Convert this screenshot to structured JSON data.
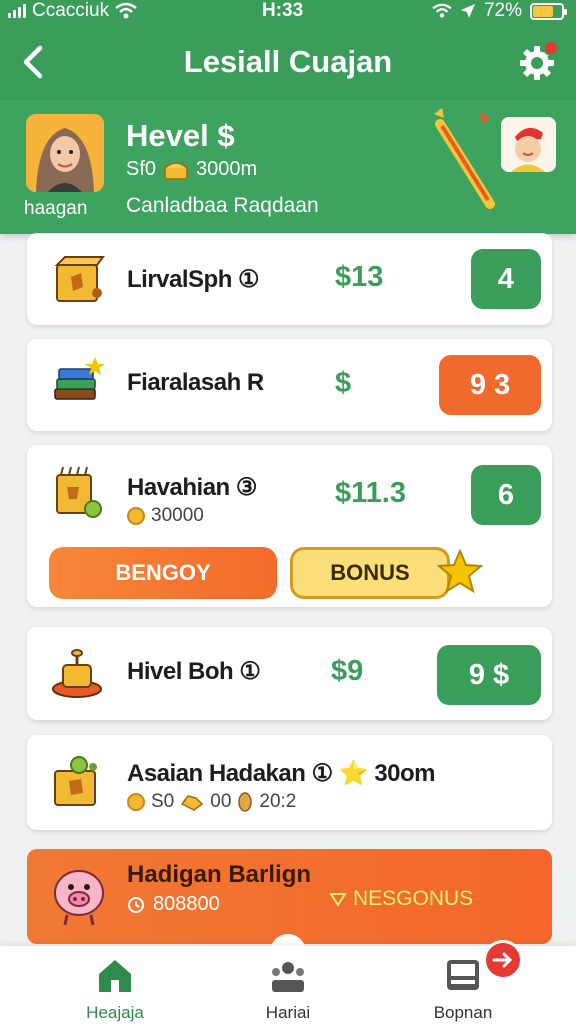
{
  "status_bar": {
    "carrier": "Ccacciuk",
    "time": "H:33",
    "battery": "72%",
    "battery_level": 0.72
  },
  "header": {
    "title": "Lesiall Cuajan"
  },
  "profile": {
    "name": "Hevel $",
    "balance_prefix": "Sf0",
    "balance_amount": "3000m",
    "subtitle": "Canladbaa Raqdaan",
    "avatar_label": "haagan"
  },
  "items": [
    {
      "label": "LirvalSph ①",
      "price": "$13",
      "action": "4"
    },
    {
      "label": "Fiaralasah R",
      "price": "$",
      "action": "9   3"
    },
    {
      "label": "Havahian ③",
      "price": "$11.3",
      "action": "6",
      "coins": "30000"
    },
    {
      "label": "Hivel Boh ①",
      "price": "$9",
      "action": "9   $"
    },
    {
      "label": "Asaian Hadakan ① ⭐ 30om",
      "stats": [
        "S0",
        "00",
        "20:2"
      ]
    }
  ],
  "offer_buttons": {
    "primary": "BENGOY",
    "secondary": "BONUS"
  },
  "promo": {
    "title": "Hadigan Barlign",
    "amount": "808800",
    "bonus": "NESGONUS"
  },
  "tabs": [
    {
      "label": "Heajaja"
    },
    {
      "label": "Hariai"
    },
    {
      "label": "Bopnan"
    }
  ],
  "colors": {
    "primary_green": "#3a9e5a",
    "accent_orange": "#ef6a2c",
    "bonus_yellow": "#fbe07a"
  }
}
